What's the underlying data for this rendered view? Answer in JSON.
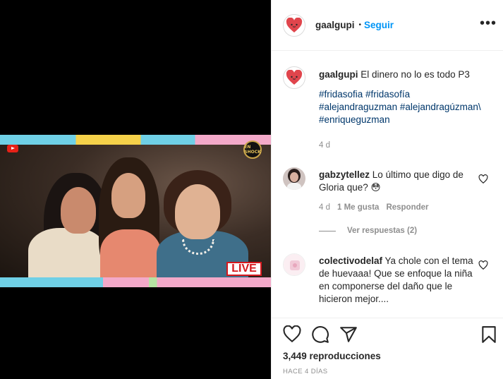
{
  "post": {
    "username": "gaalgupi",
    "follow_separator": "•",
    "follow_label": "Seguir",
    "more_label": "•••",
    "caption_text": "El dinero no lo es todo P3",
    "hashtags": [
      "#fridasofia #fridasofía",
      "#alejandraguzman #alejandragúzman\\",
      "#enriqueguzman"
    ],
    "caption_time": "4 d"
  },
  "media": {
    "live_label": "LIVE",
    "channel_badge": "EN SHOCK",
    "accent_colors": {
      "cyan": "#6fd0e6",
      "yellow": "#f5d14a",
      "pink": "#f3a9c9",
      "live_red": "#d6181d"
    }
  },
  "comments": [
    {
      "username": "gabzytellez",
      "text": "Lo último que digo de Gloria que? 😳",
      "time": "4 d",
      "likes": "1 Me gusta",
      "reply_label": "Responder",
      "view_replies": "Ver respuestas (2)"
    },
    {
      "username": "colectivodelaf",
      "text": "Ya chole con el tema de huevaaa! Que se enfoque la niña en componerse del daño que le hicieron mejor...."
    }
  ],
  "footer": {
    "views": "3,449 reproducciones",
    "posted": "HACE 4 DÍAS"
  },
  "colors": {
    "link_blue": "#0095f6",
    "hashtag_blue": "#00376b",
    "muted_gray": "#8e8e8e",
    "text": "#262626"
  }
}
